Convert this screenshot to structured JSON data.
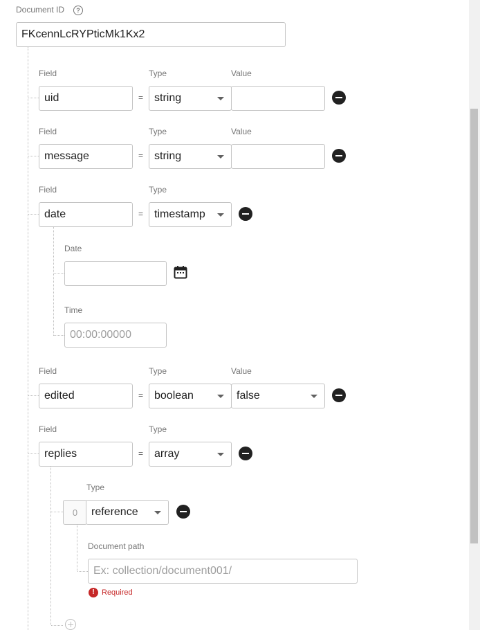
{
  "document_id": {
    "label": "Document ID",
    "value": "FKcennLcRYPticMk1Kx2"
  },
  "labels": {
    "field": "Field",
    "type": "Type",
    "value": "Value",
    "equals": "="
  },
  "fields": [
    {
      "name": "uid",
      "type": "string",
      "value": ""
    },
    {
      "name": "message",
      "type": "string",
      "value": ""
    },
    {
      "name": "date",
      "type": "timestamp"
    },
    {
      "name": "edited",
      "type": "boolean",
      "value": "false"
    },
    {
      "name": "replies",
      "type": "array"
    }
  ],
  "timestamp": {
    "date_label": "Date",
    "date_value": "",
    "time_label": "Time",
    "time_placeholder": "00:00:00000"
  },
  "array_item": {
    "index": "0",
    "type_label": "Type",
    "type": "reference",
    "path_label": "Document path",
    "path_placeholder": "Ex: collection/document001/",
    "error": "Required"
  }
}
